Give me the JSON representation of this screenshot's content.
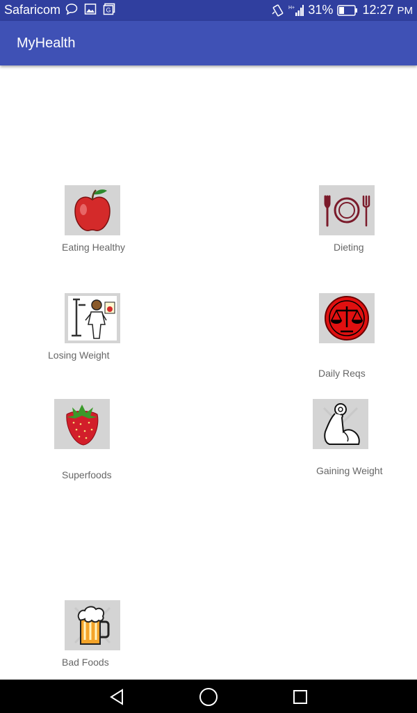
{
  "status_bar": {
    "carrier": "Safaricom",
    "battery": "31%",
    "time": "12:27",
    "time_suffix": "PM",
    "network": "H+"
  },
  "app_bar": {
    "title": "MyHealth",
    "color": "#3F51B5"
  },
  "menu": [
    {
      "label": "Eating Healthy",
      "icon": "apple-icon"
    },
    {
      "label": "Dieting",
      "icon": "plate-utensils-icon"
    },
    {
      "label": "Losing Weight",
      "icon": "weighing-scale-person-icon"
    },
    {
      "label": "Daily Reqs",
      "icon": "balance-scale-icon"
    },
    {
      "label": "Superfoods",
      "icon": "strawberry-icon"
    },
    {
      "label": "Gaining Weight",
      "icon": "flexed-arm-icon"
    },
    {
      "label": "Bad Foods",
      "icon": "beer-mug-icon"
    }
  ]
}
